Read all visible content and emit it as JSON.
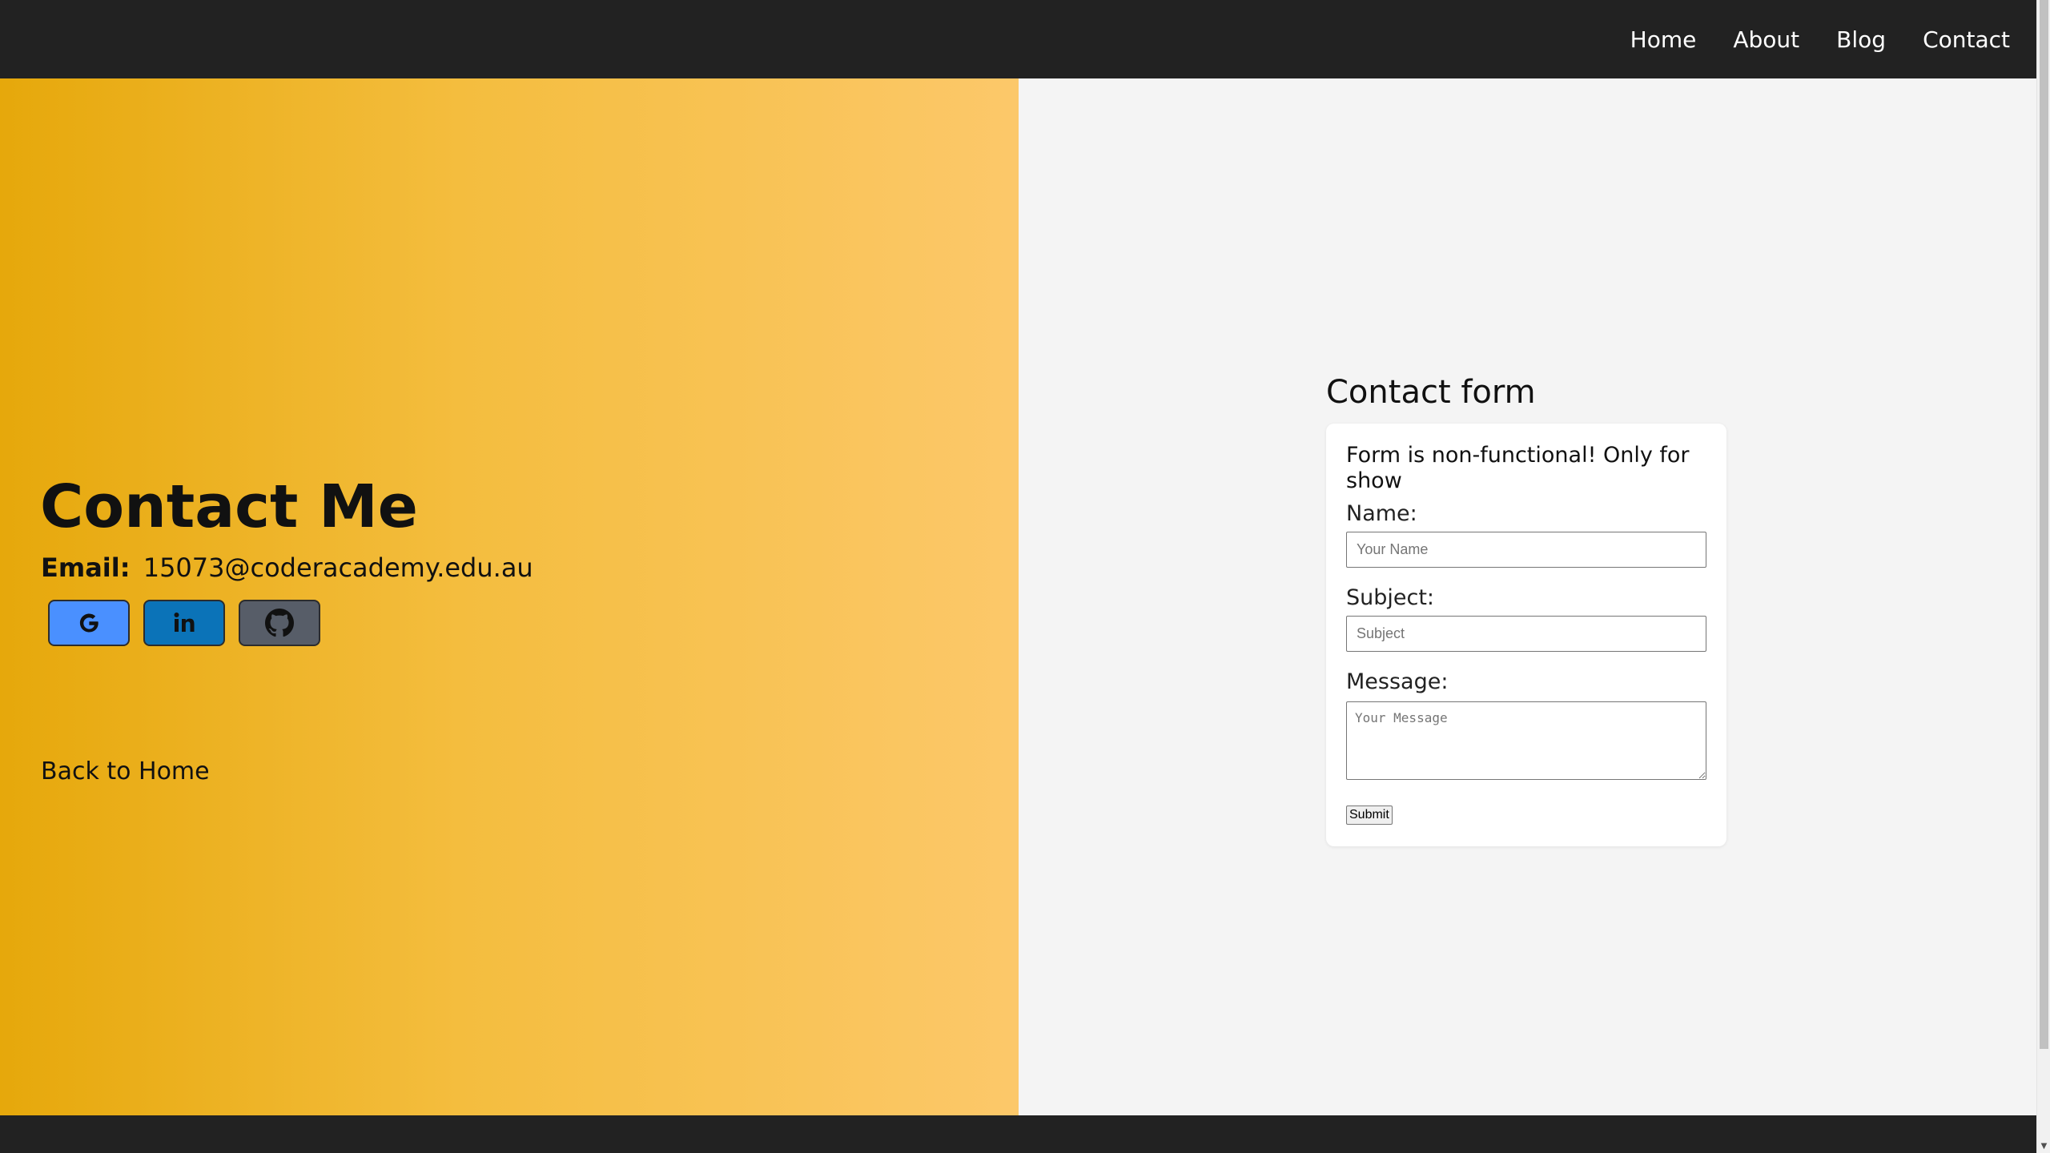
{
  "nav": {
    "items": [
      {
        "label": "Home"
      },
      {
        "label": "About"
      },
      {
        "label": "Blog"
      },
      {
        "label": "Contact"
      }
    ]
  },
  "contact": {
    "title": "Contact Me",
    "email_label": "Email:",
    "email": "15073@coderacademy.edu.au",
    "social": [
      {
        "name": "google",
        "icon": "google-icon",
        "color": "#4a90ff"
      },
      {
        "name": "linkedin",
        "icon": "linkedin-icon",
        "color": "#0b73b8"
      },
      {
        "name": "github",
        "icon": "github-icon",
        "color": "#575d68"
      }
    ],
    "back_link": "Back to Home"
  },
  "form": {
    "heading": "Contact form",
    "notice": "Form is non-functional! Only for show",
    "name_label": "Name:",
    "name_placeholder": "Your Name",
    "subject_label": "Subject:",
    "subject_placeholder": "Subject",
    "message_label": "Message:",
    "message_placeholder": "Your Message",
    "submit_label": "Submit"
  },
  "colors": {
    "nav_bg": "#222222",
    "panel_gradient_start": "#e6a80b",
    "panel_gradient_end": "#fcc86a",
    "right_bg": "#f4f4f4"
  }
}
